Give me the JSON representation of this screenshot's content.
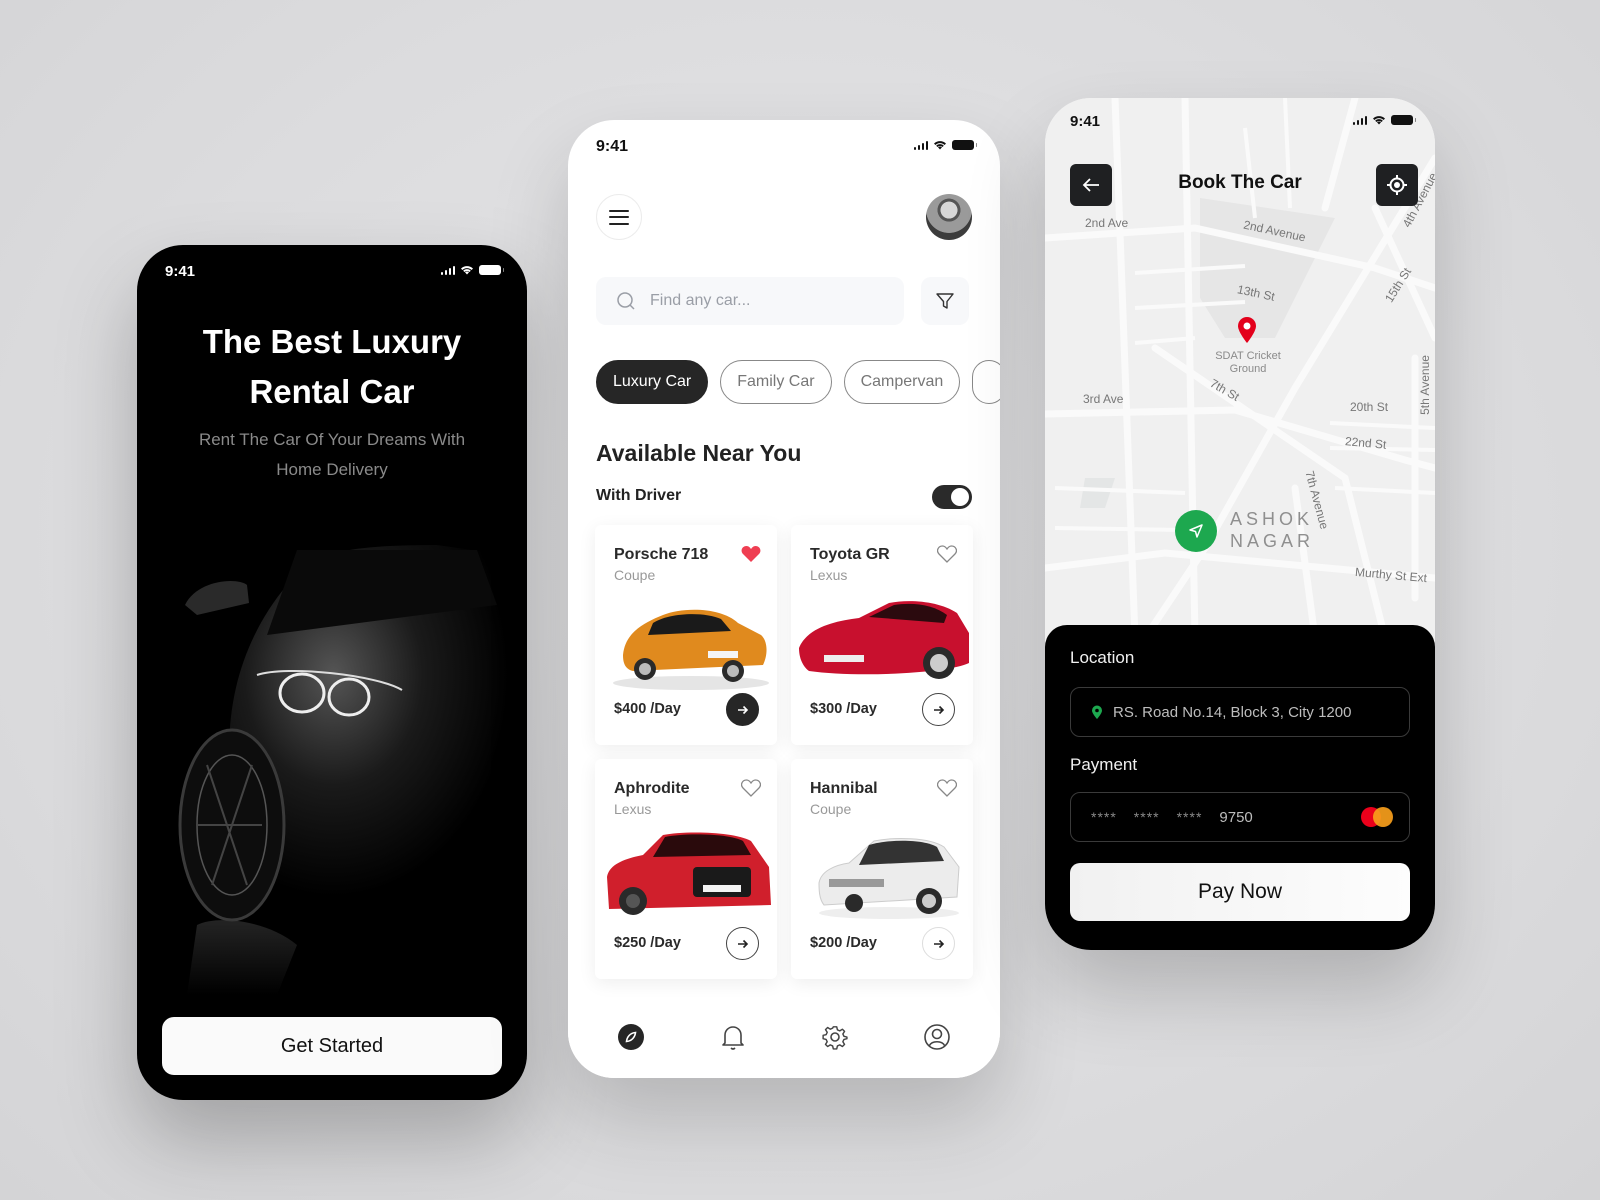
{
  "status_bar": {
    "time": "9:41"
  },
  "onboarding": {
    "title": "The Best Luxury Rental Car",
    "subtitle": "Rent The Car Of Your Dreams With Home Delivery",
    "cta_label": "Get Started"
  },
  "home": {
    "search": {
      "placeholder": "Find any car...",
      "value": ""
    },
    "categories": [
      {
        "label": "Luxury Car",
        "active": true
      },
      {
        "label": "Family Car",
        "active": false
      },
      {
        "label": "Campervan",
        "active": false
      }
    ],
    "section_title": "Available Near You",
    "with_driver": {
      "label": "With Driver",
      "on": true
    },
    "cars": [
      {
        "name": "Porsche 718",
        "type": "Coupe",
        "price": "$400 /Day",
        "favorite": true,
        "color": "#e08a1e"
      },
      {
        "name": "Toyota GR",
        "type": "Lexus",
        "price": "$300 /Day",
        "favorite": false,
        "color": "#c8102e"
      },
      {
        "name": "Aphrodite",
        "type": "Lexus",
        "price": "$250 /Day",
        "favorite": false,
        "color": "#d01f2c"
      },
      {
        "name": "Hannibal",
        "type": "Coupe",
        "price": "$200 /Day",
        "favorite": false,
        "color": "#e8e8e8"
      }
    ],
    "tabs": [
      {
        "icon": "compass-icon",
        "active": true
      },
      {
        "icon": "bell-icon",
        "active": false
      },
      {
        "icon": "gear-icon",
        "active": false
      },
      {
        "icon": "profile-icon",
        "active": false
      }
    ]
  },
  "booking": {
    "title": "Book The Car",
    "map_labels": {
      "a": "2nd Ave",
      "b": "2nd Avenue",
      "c": "4th Avenue",
      "d": "13th St",
      "e": "15th St",
      "f": "3rd Ave",
      "g": "7th St",
      "h": "20th St",
      "i": "5th Avenue",
      "j": "22nd St",
      "k": "7th Avenue",
      "l": "Murthy St Ext"
    },
    "poi": "SDAT Cricket Ground",
    "area": "ASHOK NAGAR",
    "location_label": "Location",
    "location_value": "RS. Road No.14, Block 3, City 1200",
    "payment_label": "Payment",
    "card_mask": [
      "****",
      "****",
      "****"
    ],
    "card_last4": "9750",
    "pay_label": "Pay Now",
    "accent_green": "#1da84f",
    "pin_red": "#e3001b"
  }
}
